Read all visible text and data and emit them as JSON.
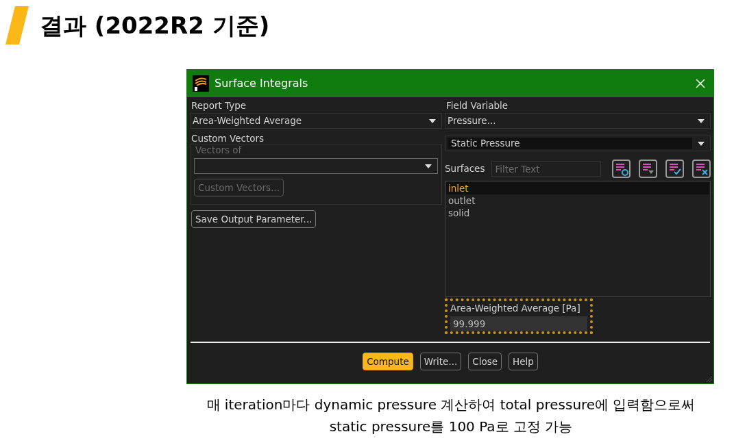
{
  "slide_title": "결과 (2022R2 기준)",
  "dialog": {
    "title": "Surface Integrals",
    "report_type": {
      "label": "Report Type",
      "value": "Area-Weighted Average"
    },
    "custom_vectors": {
      "label": "Custom Vectors",
      "vectors_of_label": "Vectors of",
      "disabled": true,
      "button": "Custom Vectors..."
    },
    "save_button": "Save Output Parameter...",
    "field_variable": {
      "label": "Field Variable",
      "value": "Pressure...",
      "sub_value": "Static Pressure"
    },
    "surfaces": {
      "label": "Surfaces",
      "filter_placeholder": "Filter Text",
      "tool_buttons": [
        {
          "kind": "circle"
        },
        {
          "kind": "dropdown"
        },
        {
          "kind": "check"
        },
        {
          "kind": "cross"
        }
      ],
      "items": [
        {
          "label": "inlet",
          "selected": true
        },
        {
          "label": "outlet",
          "selected": false
        },
        {
          "label": "solid",
          "selected": false
        }
      ]
    },
    "result": {
      "label": "Area-Weighted Average [Pa]",
      "value": "99.999",
      "highlighted": true
    },
    "buttons": [
      {
        "label": "Compute",
        "primary": true
      },
      {
        "label": "Write...",
        "primary": false
      },
      {
        "label": "Close",
        "primary": false
      },
      {
        "label": "Help",
        "primary": false
      }
    ]
  },
  "caption": [
    "매 iteration마다 dynamic pressure 계산하여 total pressure에 입력함으로써",
    "static pressure를 100 Pa로 고정 가능"
  ]
}
